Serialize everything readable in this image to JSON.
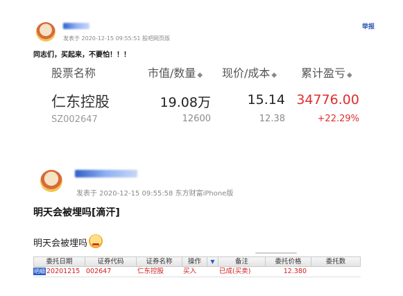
{
  "post1": {
    "meta": "发表于 2020-12-15 09:55:51 股吧网页版",
    "report": "举报",
    "text": "同志们，买起来，不要怕！！！",
    "headers": {
      "name": "股票名称",
      "value_qty": "市值/数量",
      "price_cost": "现价/成本",
      "profit": "累计盈亏"
    },
    "sort_icon": "◆",
    "stock": {
      "name": "仁东控股",
      "code": "SZ002647",
      "market_value": "19.08万",
      "quantity": "12600",
      "price": "15.14",
      "cost": "12.38",
      "profit": "34776.00",
      "profit_pct": "+22.29%"
    }
  },
  "post2": {
    "meta": "发表于 2020-12-15 09:55:58 东方财富iPhone版",
    "title": "明天会被埋吗[滴汗]",
    "body": "明天会被埋吗",
    "table": {
      "columns": [
        "委托日期",
        "证券代码",
        "证券名称",
        "操作",
        "▼",
        "备注",
        "委托价格",
        "委托数"
      ],
      "row": {
        "tag": "明细",
        "date": "20201215",
        "code": "002647",
        "name": "仁东控股",
        "op": "买入",
        "note": "已成(买卖)",
        "price": "12.380",
        "qty": ""
      }
    }
  },
  "colors": {
    "profit_red": "#e02d2d",
    "link_blue": "#2e55b8"
  }
}
